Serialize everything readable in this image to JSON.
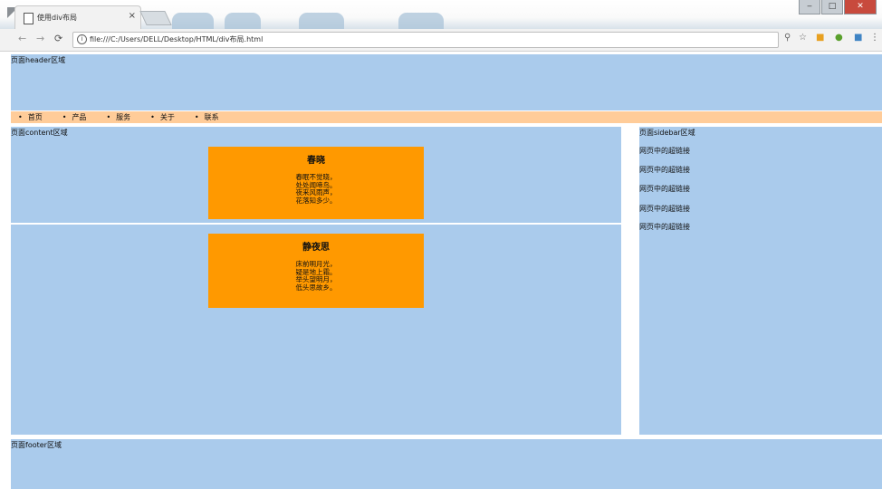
{
  "browser": {
    "tab_title": "使用div布局",
    "tab_close": "×",
    "address_url": "file:///C:/Users/DELL/Desktop/HTML/div布局.html",
    "minimize": "‒",
    "maximize": "□",
    "close": "✕"
  },
  "page": {
    "header_label": "页面header区域",
    "nav_bullet": "•",
    "nav_items": [
      "首页",
      "产品",
      "服务",
      "关于",
      "联系"
    ],
    "content_label": "页面content区域",
    "box1": {
      "title": "春晓",
      "lines": [
        "春眠不觉晓，",
        "处处闻啼鸟。",
        "夜来风雨声，",
        "花落知多少。"
      ]
    },
    "box2": {
      "title": "静夜思",
      "lines": [
        "床前明月光，",
        "疑是地上霜。",
        "举头望明月，",
        "低头思故乡。"
      ]
    },
    "sidebar_label": "页面sidebar区域",
    "sidebar_links": [
      "网页中的超链接",
      "网页中的超链接",
      "网页中的超链接",
      "网页中的超链接",
      "网页中的超链接"
    ],
    "footer_label": "页面footer区域"
  },
  "colors": {
    "layout_blue": "#aacbec",
    "nav_peach": "#ffcc99",
    "box_orange": "#ff9900"
  }
}
